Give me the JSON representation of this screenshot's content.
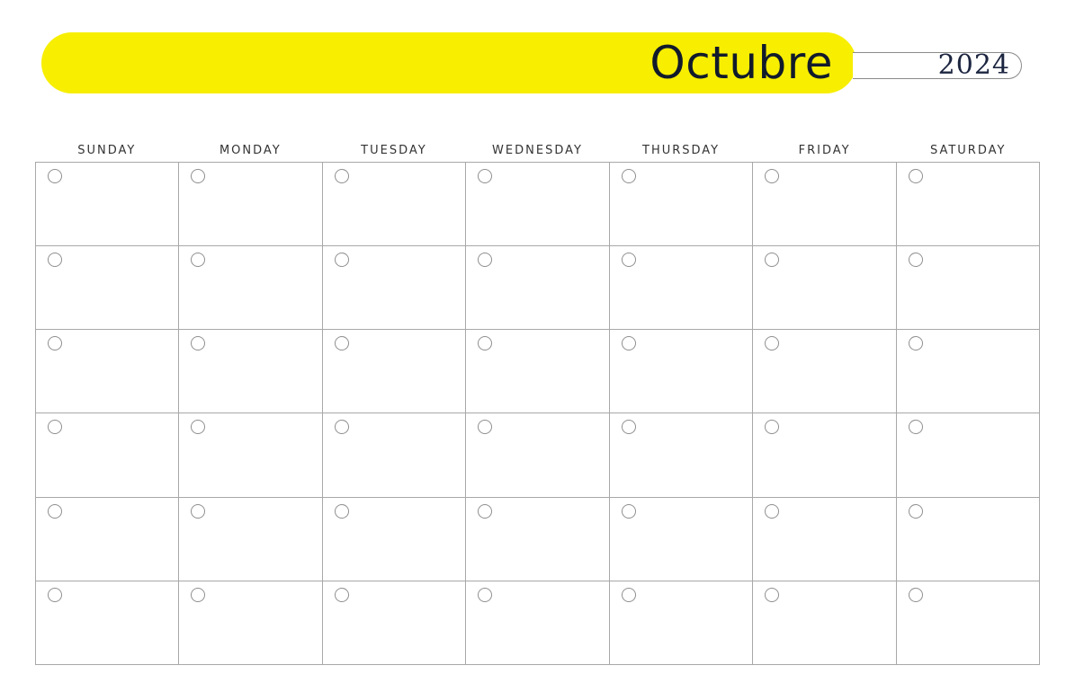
{
  "header": {
    "month": "Octubre",
    "year": "2024",
    "banner_color": "#f7ee00",
    "title_color": "#111a2b"
  },
  "weekdays": [
    "SUNDAY",
    "MONDAY",
    "TUESDAY",
    "WEDNESDAY",
    "THURSDAY",
    "FRIDAY",
    "SATURDAY"
  ],
  "calendar": {
    "rows": 6,
    "columns": 7,
    "line_color": "#a8a8a8",
    "cell_marker": "circle-icon"
  }
}
